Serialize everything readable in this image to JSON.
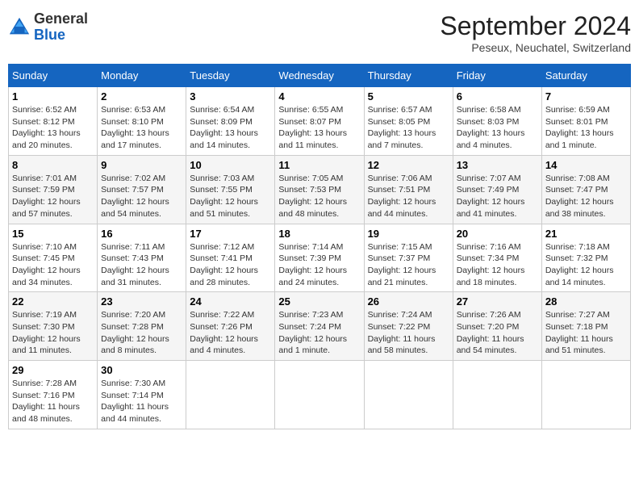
{
  "header": {
    "logo_general": "General",
    "logo_blue": "Blue",
    "month_title": "September 2024",
    "location": "Peseux, Neuchatel, Switzerland"
  },
  "days_of_week": [
    "Sunday",
    "Monday",
    "Tuesday",
    "Wednesday",
    "Thursday",
    "Friday",
    "Saturday"
  ],
  "weeks": [
    [
      {
        "day": "1",
        "sunrise": "6:52 AM",
        "sunset": "8:12 PM",
        "daylight": "13 hours and 20 minutes."
      },
      {
        "day": "2",
        "sunrise": "6:53 AM",
        "sunset": "8:10 PM",
        "daylight": "13 hours and 17 minutes."
      },
      {
        "day": "3",
        "sunrise": "6:54 AM",
        "sunset": "8:09 PM",
        "daylight": "13 hours and 14 minutes."
      },
      {
        "day": "4",
        "sunrise": "6:55 AM",
        "sunset": "8:07 PM",
        "daylight": "13 hours and 11 minutes."
      },
      {
        "day": "5",
        "sunrise": "6:57 AM",
        "sunset": "8:05 PM",
        "daylight": "13 hours and 7 minutes."
      },
      {
        "day": "6",
        "sunrise": "6:58 AM",
        "sunset": "8:03 PM",
        "daylight": "13 hours and 4 minutes."
      },
      {
        "day": "7",
        "sunrise": "6:59 AM",
        "sunset": "8:01 PM",
        "daylight": "13 hours and 1 minute."
      }
    ],
    [
      {
        "day": "8",
        "sunrise": "7:01 AM",
        "sunset": "7:59 PM",
        "daylight": "12 hours and 57 minutes."
      },
      {
        "day": "9",
        "sunrise": "7:02 AM",
        "sunset": "7:57 PM",
        "daylight": "12 hours and 54 minutes."
      },
      {
        "day": "10",
        "sunrise": "7:03 AM",
        "sunset": "7:55 PM",
        "daylight": "12 hours and 51 minutes."
      },
      {
        "day": "11",
        "sunrise": "7:05 AM",
        "sunset": "7:53 PM",
        "daylight": "12 hours and 48 minutes."
      },
      {
        "day": "12",
        "sunrise": "7:06 AM",
        "sunset": "7:51 PM",
        "daylight": "12 hours and 44 minutes."
      },
      {
        "day": "13",
        "sunrise": "7:07 AM",
        "sunset": "7:49 PM",
        "daylight": "12 hours and 41 minutes."
      },
      {
        "day": "14",
        "sunrise": "7:08 AM",
        "sunset": "7:47 PM",
        "daylight": "12 hours and 38 minutes."
      }
    ],
    [
      {
        "day": "15",
        "sunrise": "7:10 AM",
        "sunset": "7:45 PM",
        "daylight": "12 hours and 34 minutes."
      },
      {
        "day": "16",
        "sunrise": "7:11 AM",
        "sunset": "7:43 PM",
        "daylight": "12 hours and 31 minutes."
      },
      {
        "day": "17",
        "sunrise": "7:12 AM",
        "sunset": "7:41 PM",
        "daylight": "12 hours and 28 minutes."
      },
      {
        "day": "18",
        "sunrise": "7:14 AM",
        "sunset": "7:39 PM",
        "daylight": "12 hours and 24 minutes."
      },
      {
        "day": "19",
        "sunrise": "7:15 AM",
        "sunset": "7:37 PM",
        "daylight": "12 hours and 21 minutes."
      },
      {
        "day": "20",
        "sunrise": "7:16 AM",
        "sunset": "7:34 PM",
        "daylight": "12 hours and 18 minutes."
      },
      {
        "day": "21",
        "sunrise": "7:18 AM",
        "sunset": "7:32 PM",
        "daylight": "12 hours and 14 minutes."
      }
    ],
    [
      {
        "day": "22",
        "sunrise": "7:19 AM",
        "sunset": "7:30 PM",
        "daylight": "12 hours and 11 minutes."
      },
      {
        "day": "23",
        "sunrise": "7:20 AM",
        "sunset": "7:28 PM",
        "daylight": "12 hours and 8 minutes."
      },
      {
        "day": "24",
        "sunrise": "7:22 AM",
        "sunset": "7:26 PM",
        "daylight": "12 hours and 4 minutes."
      },
      {
        "day": "25",
        "sunrise": "7:23 AM",
        "sunset": "7:24 PM",
        "daylight": "12 hours and 1 minute."
      },
      {
        "day": "26",
        "sunrise": "7:24 AM",
        "sunset": "7:22 PM",
        "daylight": "11 hours and 58 minutes."
      },
      {
        "day": "27",
        "sunrise": "7:26 AM",
        "sunset": "7:20 PM",
        "daylight": "11 hours and 54 minutes."
      },
      {
        "day": "28",
        "sunrise": "7:27 AM",
        "sunset": "7:18 PM",
        "daylight": "11 hours and 51 minutes."
      }
    ],
    [
      {
        "day": "29",
        "sunrise": "7:28 AM",
        "sunset": "7:16 PM",
        "daylight": "11 hours and 48 minutes."
      },
      {
        "day": "30",
        "sunrise": "7:30 AM",
        "sunset": "7:14 PM",
        "daylight": "11 hours and 44 minutes."
      },
      null,
      null,
      null,
      null,
      null
    ]
  ],
  "labels": {
    "sunrise": "Sunrise:",
    "sunset": "Sunset:",
    "daylight": "Daylight:"
  }
}
